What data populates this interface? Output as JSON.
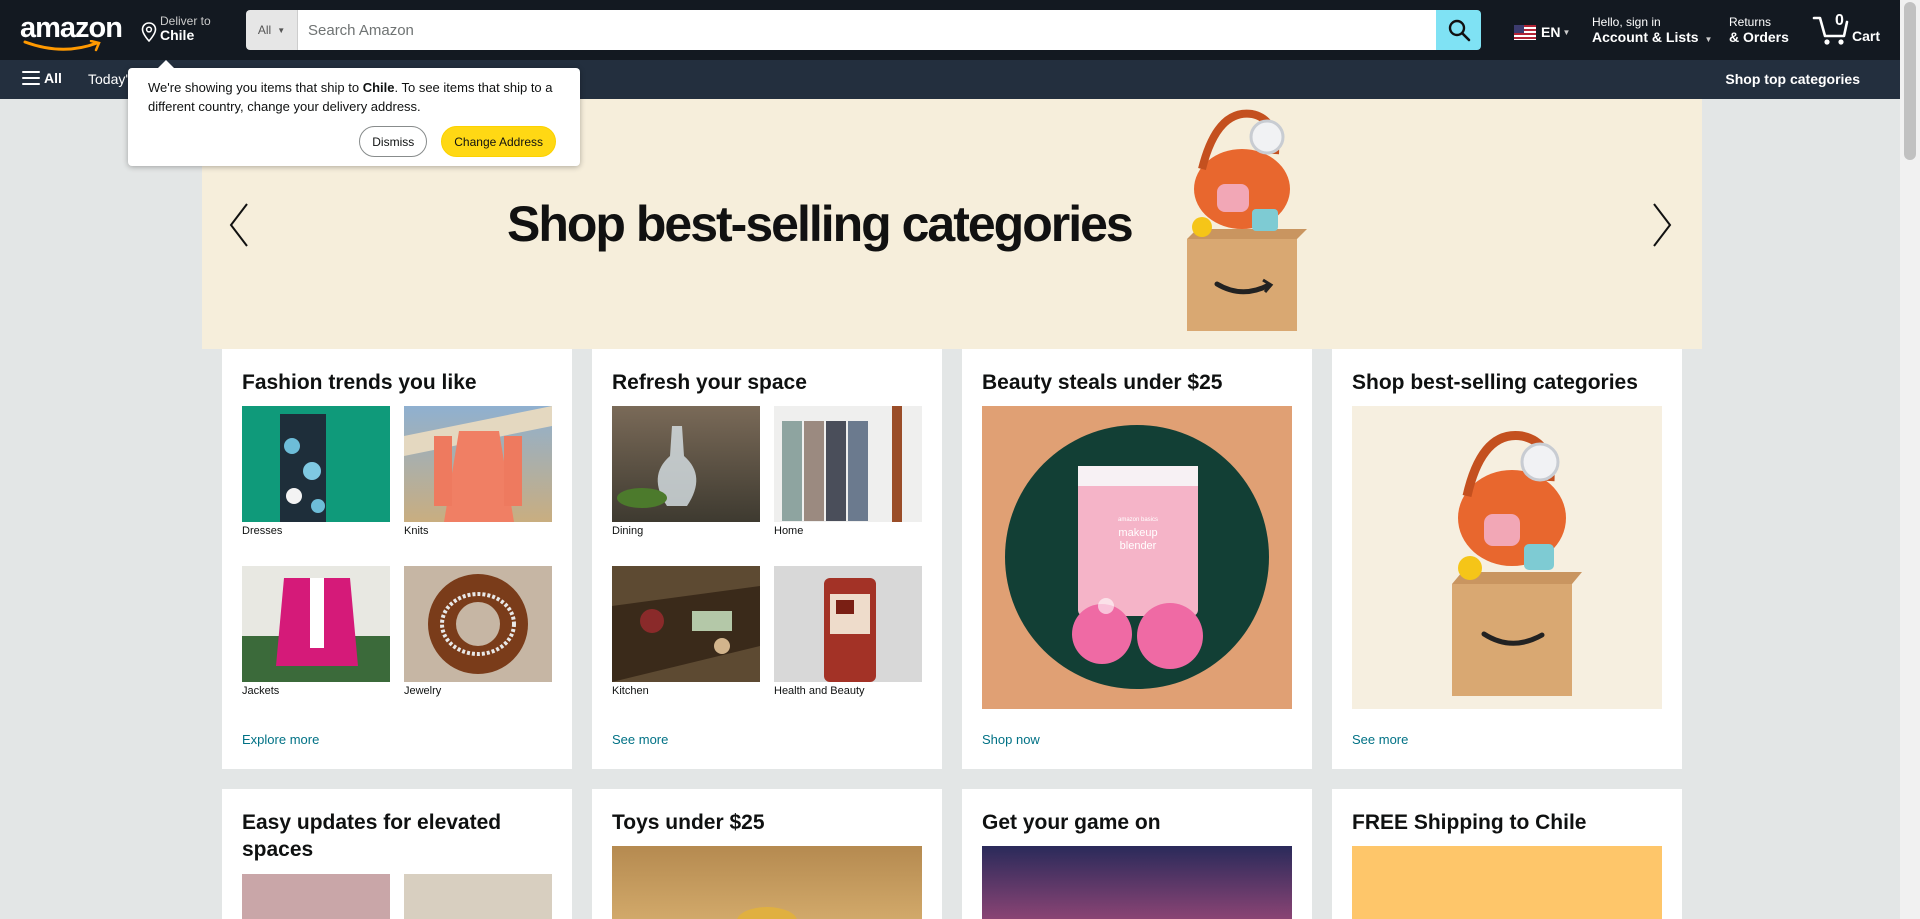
{
  "header": {
    "logo_text": "amazon",
    "deliver_to_label": "Deliver to",
    "deliver_to_country": "Chile",
    "search_category": "All",
    "search_placeholder": "Search Amazon",
    "language": "EN",
    "account_line1": "Hello, sign in",
    "account_line2": "Account & Lists",
    "returns_line1": "Returns",
    "returns_line2": "& Orders",
    "cart_count": "0",
    "cart_label": "Cart"
  },
  "subnav": {
    "all_label": "All",
    "todays_label": "Today's",
    "shop_top_label": "Shop top categories"
  },
  "popup": {
    "text_before": "We're showing you items that ship to ",
    "country": "Chile",
    "text_after": ". To see items that ship to a different country, change your delivery address.",
    "dismiss_label": "Dismiss",
    "change_label": "Change Address"
  },
  "hero": {
    "title": "Shop best-selling categories"
  },
  "cards": [
    {
      "title": "Fashion trends you like",
      "items": [
        "Dresses",
        "Knits",
        "Jackets",
        "Jewelry"
      ],
      "link": "Explore more"
    },
    {
      "title": "Refresh your space",
      "items": [
        "Dining",
        "Home",
        "Kitchen",
        "Health and Beauty"
      ],
      "link": "See more"
    },
    {
      "title": "Beauty steals under $25",
      "link": "Shop now",
      "product_brand": "amazon basics",
      "product_line1": "makeup",
      "product_line2": "blender"
    },
    {
      "title": "Shop best-selling categories",
      "link": "See more"
    },
    {
      "title": "Easy updates for elevated spaces"
    },
    {
      "title": "Toys under $25"
    },
    {
      "title": "Get your game on"
    },
    {
      "title": "FREE Shipping to Chile"
    }
  ],
  "colors": {
    "nav_dark": "#131921",
    "nav_sub": "#232f3e",
    "search_button": "#7fe2f4",
    "accent_orange": "#ff9900",
    "link_teal": "#007185",
    "change_button": "#ffd814",
    "hero_bg": "#f6eedb"
  },
  "icons": [
    "location-pin-icon",
    "search-icon",
    "us-flag-icon",
    "cart-icon",
    "hamburger-icon",
    "chevron-left-icon",
    "chevron-right-icon"
  ]
}
